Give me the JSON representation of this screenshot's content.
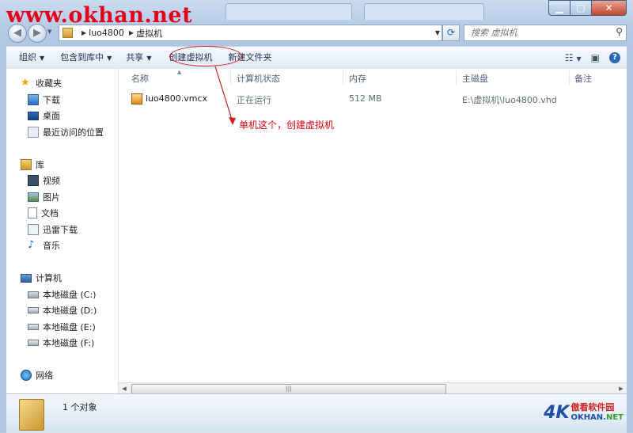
{
  "watermark": "www.okhan.net",
  "address": {
    "crumbs": [
      "luo4800",
      "虚拟机"
    ],
    "search_placeholder": "搜索 虚拟机"
  },
  "toolbar": {
    "organize": "组织",
    "include_in_library": "包含到库中",
    "share": "共享",
    "create_vm": "创建虚拟机",
    "new_folder": "新建文件夹"
  },
  "navpane": {
    "favorites": {
      "title": "收藏夹",
      "items": [
        "下载",
        "桌面",
        "最近访问的位置"
      ]
    },
    "libraries": {
      "title": "库",
      "items": [
        "视频",
        "图片",
        "文档",
        "迅雷下载",
        "音乐"
      ]
    },
    "computer": {
      "title": "计算机",
      "items": [
        "本地磁盘 (C:)",
        "本地磁盘 (D:)",
        "本地磁盘 (E:)",
        "本地磁盘 (F:)"
      ]
    },
    "network": {
      "title": "网络"
    }
  },
  "columns": [
    "名称",
    "计算机状态",
    "内存",
    "主磁盘",
    "备注"
  ],
  "files": [
    {
      "name": "luo4800.vmcx",
      "status": "正在运行",
      "memory": "512 MB",
      "disk": "E:\\虚拟机\\luo4800.vhd",
      "note": ""
    }
  ],
  "annotation": "单机这个，创建虚拟机",
  "status": {
    "count_text": "1 个对象"
  },
  "brand": {
    "cn": "傲看软件园",
    "en_main": "OKHAN.",
    "en_suffix": "NET"
  },
  "colors": {
    "annotation": "#e60012",
    "watermark": "#e4001b",
    "accent": "#2667b8"
  }
}
